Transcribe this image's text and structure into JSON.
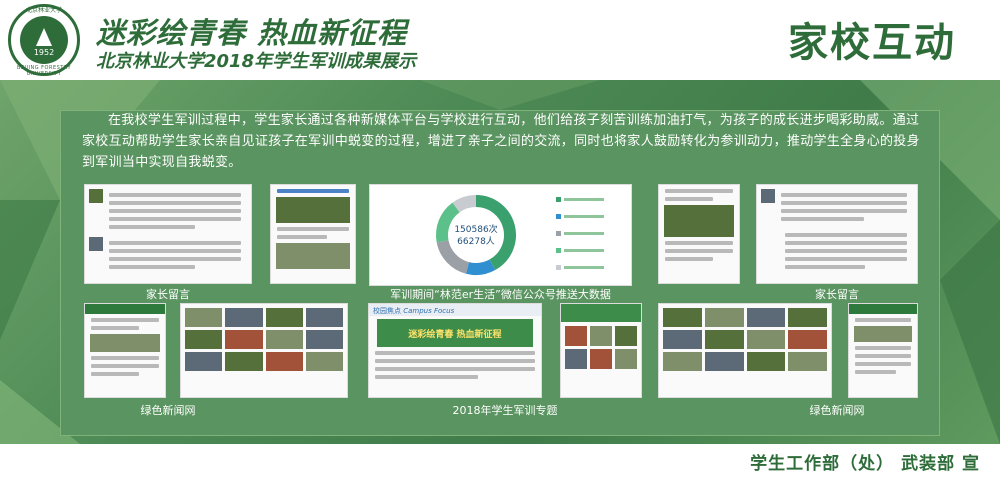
{
  "header": {
    "logo_ring_top": "北京林业大学",
    "logo_ring_bottom": "BEIJING FORESTRY UNIVERSITY",
    "logo_year": "1952",
    "title_main": "迷彩绘青春  热血新征程",
    "title_sub": "北京林业大学2018年学生军训成果展示",
    "title_right": "家校互动"
  },
  "intro": "在我校学生军训过程中，学生家长通过各种新媒体平台与学校进行互动，他们给孩子刻苦训练加油打气，为孩子的成长进步喝彩助威。通过家校互动帮助学生家长亲自见证孩子在军训中蜕变的过程，增进了亲子之间的交流，同时也将家人鼓励转化为参训动力，推动学生全身心的投身到军训当中实现自我蜕变。",
  "captions": {
    "parents_left": "家长留言",
    "wechat": "军训期间“林范er生活”微信公众号推送大数据",
    "parents_right": "家长留言",
    "news_left": "绿色新闻网",
    "special": "2018年学生军训专题",
    "news_right": "绿色新闻网"
  },
  "chart_data": {
    "type": "pie",
    "center_values": [
      "150586次",
      "66278人"
    ]
  },
  "cards": {
    "special_banner": "迷彩绘青春  热血新征程",
    "special_tag": "校园焦点",
    "special_tag_en": "Campus Focus"
  },
  "footer": "学生工作部（处）  武装部  宣",
  "colors": {
    "brand_green": "#2e6d3a",
    "board_green": "#4d8a55",
    "chart_teal": "#3aa06e",
    "chart_blue": "#2f8fd0",
    "chart_gray": "#9aa0a6"
  }
}
